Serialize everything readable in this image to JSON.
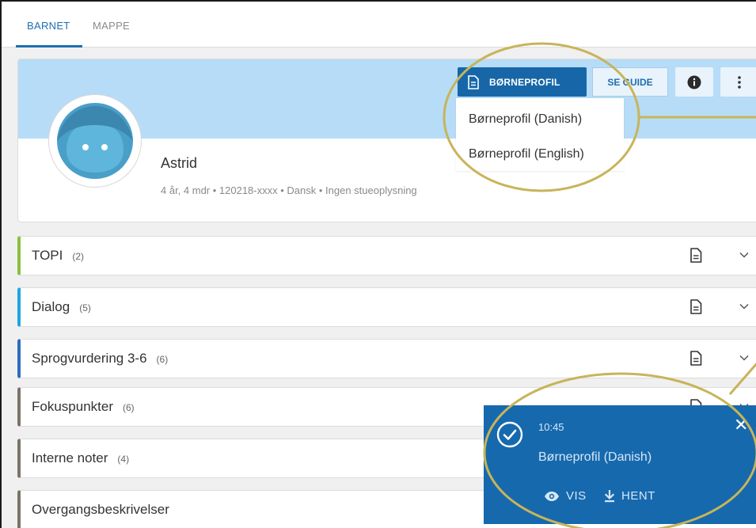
{
  "tabs": [
    {
      "label": "BARNET",
      "active": true
    },
    {
      "label": "MAPPE",
      "active": false
    }
  ],
  "profile": {
    "name": "Astrid",
    "meta": "4 år, 4 mdr • 120218-xxxx • Dansk • Ingen stueoplysning",
    "avatar_icon": "child-face-icon",
    "buttons": {
      "profile_label": "BØRNEPROFIL",
      "guide_label": "SE GUIDE",
      "info_icon": "info-icon",
      "more_icon": "more-vertical-icon"
    },
    "dropdown": [
      "Børneprofil (Danish)",
      "Børneprofil (English)"
    ]
  },
  "sections": [
    {
      "title": "TOPI",
      "count": "(2)",
      "color": "#8bbf3c"
    },
    {
      "title": "Dialog",
      "count": "(5)",
      "color": "#1ea5e0"
    },
    {
      "title": "Sprogvurdering 3-6",
      "count": "(6)",
      "color": "#2d6cc0"
    },
    {
      "title": "Fokuspunkter",
      "count": "(6)",
      "color": "#7a7468"
    },
    {
      "title": "Interne noter",
      "count": "(4)",
      "color": "#7a7468"
    },
    {
      "title": "Overgangsbeskrivelser",
      "count": "",
      "color": "#7a7468"
    }
  ],
  "toast": {
    "time": "10:45",
    "message": "Børneprofil (Danish)",
    "view_label": "VIS",
    "download_label": "HENT",
    "close_glyph": "✕"
  },
  "colors": {
    "primary": "#1767a8",
    "banner": "#b6dcf7",
    "highlight": "#c8b45a"
  }
}
